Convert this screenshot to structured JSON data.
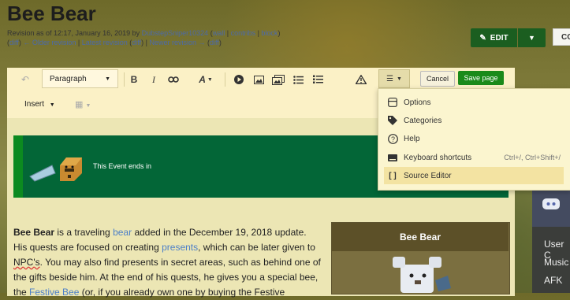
{
  "page": {
    "title": "Bee Bear",
    "revision_prefix": "Revision as of 12:17, January 16, 2019 by",
    "revision_user": "DubstepSniper10324",
    "revision_links": [
      "wall",
      "contribs",
      "block"
    ],
    "nav_links": {
      "diff1": "diff",
      "older": "← Older revision",
      "latest": "Latest revision",
      "diff2": "diff",
      "newer": "Newer revision →",
      "diff3": "diff"
    }
  },
  "actions": {
    "edit_label": "EDIT",
    "co_label": "CO"
  },
  "toolbar": {
    "paragraph_label": "Paragraph",
    "insert_label": "Insert",
    "cancel_label": "Cancel",
    "save_label": "Save page"
  },
  "dropdown": {
    "items": [
      {
        "label": "Options",
        "icon": "options-icon",
        "shortcut": ""
      },
      {
        "label": "Categories",
        "icon": "tag-icon",
        "shortcut": ""
      },
      {
        "label": "Help",
        "icon": "help-icon",
        "shortcut": ""
      },
      {
        "label": "Keyboard shortcuts",
        "icon": "keyboard-icon",
        "shortcut": "Ctrl+/, Ctrl+Shift+/"
      },
      {
        "label": "Source Editor",
        "icon": "source-icon",
        "shortcut": ""
      }
    ],
    "active_index": 4
  },
  "banner": {
    "text": "This Event ends in"
  },
  "article": {
    "bold_name": "Bee Bear",
    "t1": " is a traveling ",
    "l1": "bear",
    "t2": " added in the December 19, 2018 update. His quests are focused on creating ",
    "l2": "presents",
    "t3": ", which can be later given to ",
    "t3b": "NPC's",
    "t4": ". You may also find presents in secret areas, such as behind one of the gifts beside him. At the end of his quests, he gives you a special bee, the ",
    "l3": "Festive Bee",
    "t5": " (or, if you already own one by buying the Festive"
  },
  "infobox": {
    "title": "Bee Bear"
  },
  "sidebar": {
    "lines": [
      "User C",
      "Music",
      "AFK"
    ]
  },
  "colors": {
    "save": "#1a8a1a",
    "edit": "#1b5e20",
    "banner": "#036637",
    "link": "#4c7fc8"
  }
}
